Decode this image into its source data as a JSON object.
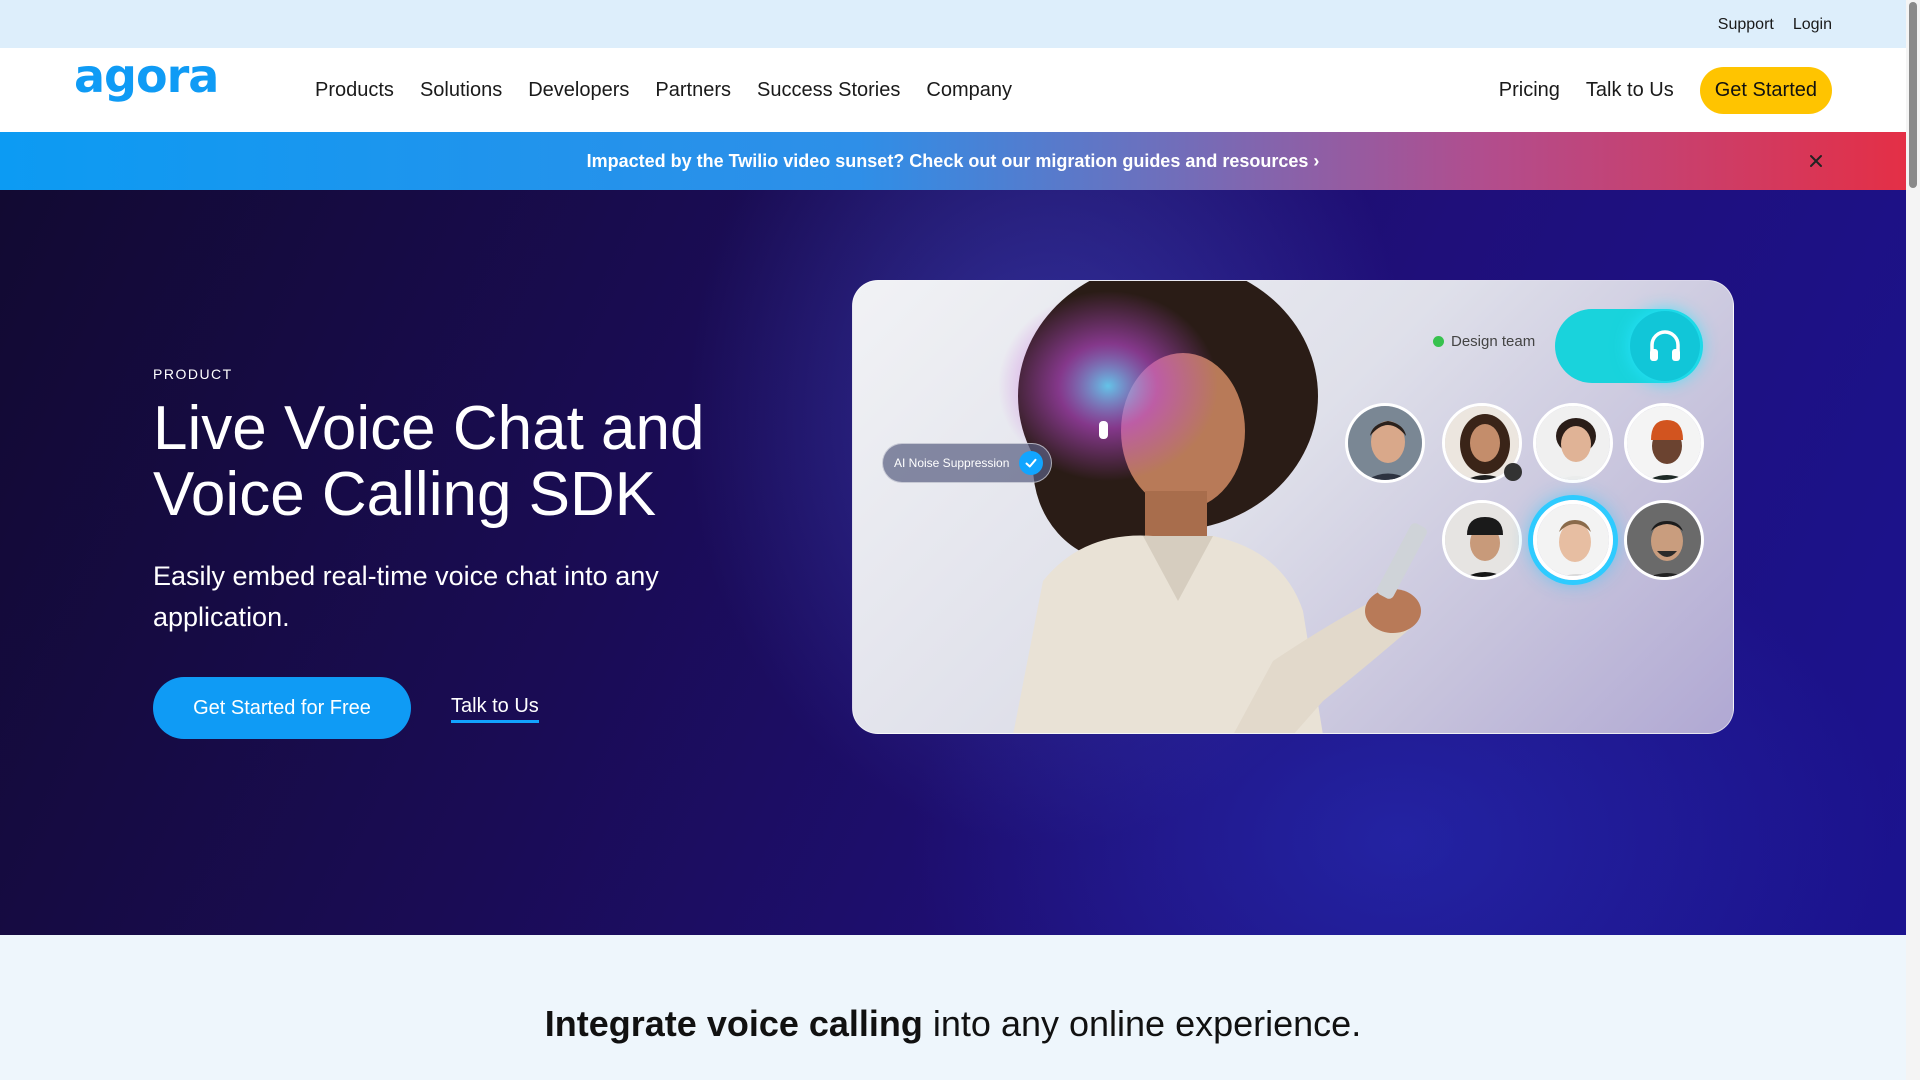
{
  "utility": {
    "support": "Support",
    "login": "Login"
  },
  "nav": {
    "logo_alt": "agora",
    "items": [
      "Products",
      "Solutions",
      "Developers",
      "Partners",
      "Success Stories",
      "Company"
    ],
    "pricing": "Pricing",
    "talk": "Talk to Us",
    "get_started": "Get Started"
  },
  "banner": {
    "text": "Impacted by the Twilio video sunset? Check out our migration guides and resources ›"
  },
  "hero": {
    "eyebrow": "PRODUCT",
    "title": "Live Voice Chat and Voice Calling SDK",
    "subtitle": "Easily embed real-time voice chat into any application.",
    "cta_primary": "Get Started for Free",
    "cta_secondary": "Talk to Us",
    "card": {
      "noise_label": "AI Noise Suppression",
      "team_label": "Design team"
    }
  },
  "intro": {
    "bold": "Integrate voice calling",
    "rest": " into any online experience."
  },
  "colors": {
    "brand_blue": "#0f9bf5",
    "cta_yellow": "#ffc400",
    "hero_dark": "#1a0c55",
    "banner_red": "#e42f46"
  },
  "icons": [
    "close-icon",
    "check-icon",
    "headphones-icon",
    "mic-off-icon",
    "chevron-right-icon"
  ]
}
